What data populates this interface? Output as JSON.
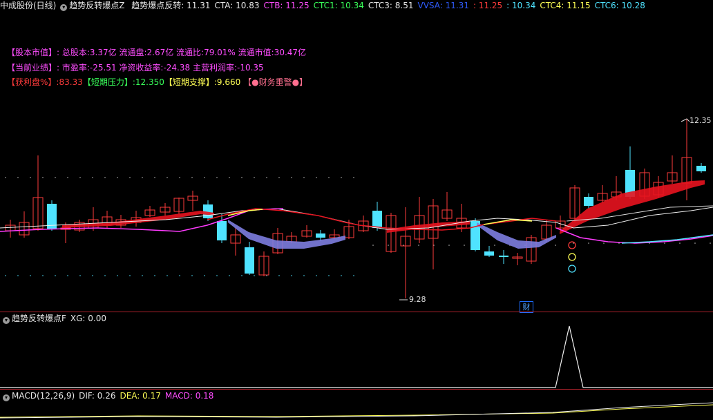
{
  "header": {
    "stock": "中成股份(日线)",
    "indicator_name": "趋势反转爆点Z",
    "items": [
      {
        "label": "趋势爆点反转:",
        "value": "11.31",
        "color": "white"
      },
      {
        "label": "CTA:",
        "value": "10.83",
        "color": "white"
      },
      {
        "label": "CTB:",
        "value": "11.25",
        "color": "mag"
      },
      {
        "label": "CTC1:",
        "value": "10.34",
        "color": "green"
      },
      {
        "label": "CTC3:",
        "value": "8.51",
        "color": "white"
      },
      {
        "label": "VVSA:",
        "value": "11.31",
        "color": "blue"
      },
      {
        "label": ":",
        "value": "11.25",
        "color": "red"
      },
      {
        "label": ":",
        "value": "10.34",
        "color": "cyan"
      },
      {
        "label": "CTC4:",
        "value": "11.15",
        "color": "yellow"
      },
      {
        "label": "CTC6:",
        "value": "10.28",
        "color": "cyan"
      }
    ]
  },
  "info": {
    "line1_tag": "【股本市值】:",
    "line1_text": "总股本:3.37亿 流通盘:2.67亿 流通比:79.01% 流通市值:30.47亿",
    "line2_tag": "【当前业绩】:",
    "line2_text": "市盈率:-25.51 净资收益率:-24.38 主营利润率:-10.35",
    "line3_a_tag": "【获利盘%】",
    "line3_a_val": ":83.33",
    "line3_b_tag": "【短期压力】",
    "line3_b_val": ":12.350",
    "line3_c_tag": "【短期支撑】",
    "line3_c_val": ":9.660",
    "line3_d": "【●财务重警●】"
  },
  "labels": {
    "high": "12.35",
    "low": "9.28",
    "cai": "财"
  },
  "panel2": {
    "title": "趋势反转爆点F",
    "item": "XG: 0.00"
  },
  "panel3": {
    "title": "MACD(12,26,9)",
    "dif": "DIF: 0.26",
    "dea": "DEA: 0.17",
    "macd": "MACD: 0.18"
  },
  "colors": {
    "up": "#ff3b3b",
    "down": "#4fe3ff",
    "ribbon_red": "#e8131f",
    "ribbon_blue": "#7d7de0"
  }
}
